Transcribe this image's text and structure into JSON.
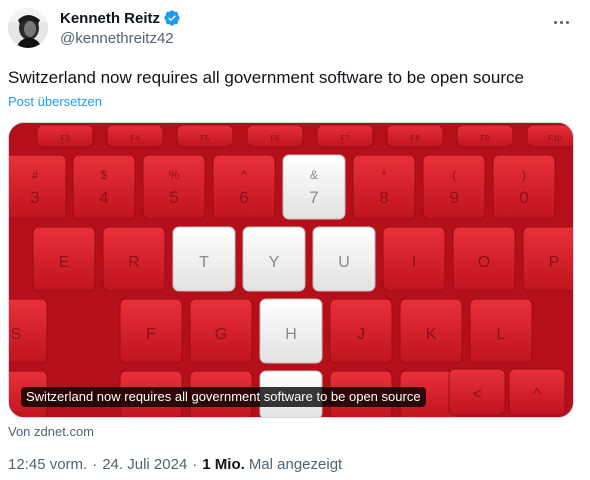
{
  "author": {
    "name": "Kenneth Reitz",
    "handle": "@kennethreitz42",
    "verified": true,
    "verified_color": "#1d9bf0",
    "avatar_icon": "avatar-photo"
  },
  "more_icon": "more-horizontal-icon",
  "tweet": {
    "text": "Switzerland now requires all government software to be open source",
    "translate_label": "Post übersetzen",
    "link_color": "#1d9bf0"
  },
  "card": {
    "caption": "Switzerland now requires all government software to be open source",
    "source": "Von zdnet.com",
    "image_description_icon": "keyboard-swiss-flag-image",
    "flag_red": "#d52b1e",
    "flag_white": "#ffffff",
    "keys": {
      "fn_row": [
        "F3",
        "F4",
        "F5",
        "F6",
        "F7",
        "F8",
        "F9",
        "F10"
      ],
      "number_row_top": [
        "#",
        "$",
        "%",
        "^",
        "&",
        "*",
        "(",
        ")"
      ],
      "number_row": [
        "3",
        "4",
        "5",
        "6",
        "7",
        "8",
        "9",
        "0"
      ],
      "letter_row_1": [
        "E",
        "R",
        "T",
        "Y",
        "U",
        "I",
        "O",
        "P"
      ],
      "letter_row_2": [
        "S",
        "F",
        "G",
        "H",
        "J",
        "K",
        "L"
      ]
    }
  },
  "meta": {
    "time": "12:45 vorm.",
    "date": "24. Juli 2024",
    "separator": "·",
    "views": "1 Mio.",
    "views_label": "Mal angezeigt"
  }
}
